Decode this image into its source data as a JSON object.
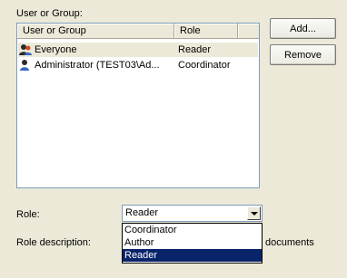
{
  "user_group_label": "User or Group:",
  "list": {
    "columns": [
      "User or Group",
      "Role",
      ""
    ],
    "rows": [
      {
        "name": "Everyone",
        "role": "Reader",
        "icon": "user-group-icon",
        "selected": true
      },
      {
        "name": "Administrator (TEST03\\Ad...",
        "role": "Coordinator",
        "icon": "user-icon",
        "selected": false
      }
    ]
  },
  "buttons": {
    "add": "Add...",
    "remove": "Remove"
  },
  "role_label": "Role:",
  "role_combo": {
    "value": "Reader",
    "options": [
      "Coordinator",
      "Author",
      "Reader"
    ],
    "selected": "Reader"
  },
  "role_description_label": "Role description:",
  "role_description_text": "documents",
  "colors": {
    "selection": "#0a246a",
    "background": "#ece9d8"
  }
}
